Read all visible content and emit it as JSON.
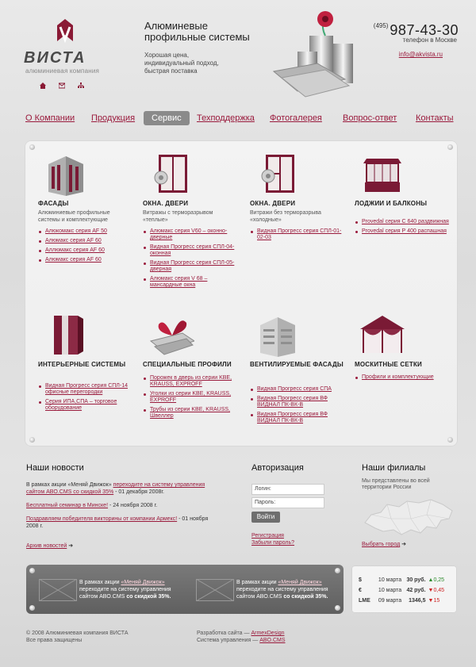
{
  "header": {
    "logo_word": "ВИСТА",
    "logo_sub": "алюминиевая компания",
    "title": "Алюминевые профильные системы",
    "slogan": "Хорошая цена, индивидуальный подход, быстрая поставка",
    "phone_code": "(495)",
    "phone_number": "987-43-30",
    "phone_label": "телефон в Москве",
    "email": "info@akvista.ru",
    "icons": [
      "home-icon",
      "mail-icon",
      "sitemap-icon"
    ]
  },
  "nav": {
    "items": [
      "О Компании",
      "Продукция",
      "Сервис",
      "Техподдержка",
      "Фотогалерея",
      "Вопрос-ответ",
      "Контакты"
    ],
    "active_index": 2
  },
  "catalog": [
    {
      "title": "ФАСАДЫ",
      "desc": "Алюминиевые профильные системы и комплектующие",
      "links": [
        "Алюкомакс серия AF 50",
        "Алюмакс серия AF 60",
        "Аллюмакс серия AF 60",
        "Алюмакс серия AF 60"
      ]
    },
    {
      "title": "ОКНА. ДВЕРИ",
      "desc": "Витражы с терморазрывом «теплые»",
      "links": [
        "Алюмакс серия V60 – оконно-дверные",
        "Видная Прогресс серия СПЛ-04-оконная",
        "Видная Прогресс серия СПЛ-05- дверная",
        "Алюмакс серия V 68 – мансардные окна"
      ]
    },
    {
      "title": "ОКНА. ДВЕРИ",
      "desc": "Витражи без терморазрыва «холодные»",
      "links": [
        "Видная Прогресс серия СПЛ-01-02-03"
      ]
    },
    {
      "title": "ЛОДЖИИ И БАЛКОНЫ",
      "desc": "",
      "links": [
        "Provedal серия С 640 раздвижная",
        "Provedal серия Р 400 распашная"
      ]
    },
    {
      "title": "ИНТЕРЬЕРНЫЕ СИСТЕМЫ",
      "desc": "",
      "links": [
        "Видная Прогресс серия СПЛ-14 офисные перегородки",
        "Серия ИПА,СПА – торговое оборудование"
      ]
    },
    {
      "title": "СПЕЦИАЛЬНЫЕ ПРОФИЛИ",
      "desc": "",
      "links": [
        "Порожек в дверь из серии KBE, KRAUSS, EXPROFF",
        "Уголки из серии KBE, KRAUSS, EXPROFF",
        "Трубы из серии KBE, KRAUSS, Швеллер"
      ]
    },
    {
      "title": "ВЕНТИЛИРУЕМЫЕ ФАСАДЫ",
      "desc": "",
      "links": [
        "Видная Прогресс серия СПА",
        "Видная Прогресс серия ВФ ВИДНАЛ ПК-ВК-В",
        "Видная Прогресс серия ВФ ВИДНАЛ ПК-ВК-В"
      ]
    },
    {
      "title": "МОСКИТНЫЕ СЕТКИ",
      "desc": "",
      "links": [
        "Профили и комплектующие"
      ]
    }
  ],
  "news": {
    "title": "Наши новости",
    "items": [
      {
        "pre": "В рамках акции «Меняй Движок» ",
        "link": "переходите на систему управления сайтом ABO.CMS со скидкой 35%",
        "post": " - 01 декабря 2008г."
      },
      {
        "pre": "",
        "link": "Бесплатный семинар в Минске!",
        "post": " - 24 ноября 2008 г."
      },
      {
        "pre": "",
        "link": "Поздравляем победителя викторины от компании Армекс!",
        "post": " - 01 ноября 2008 г."
      }
    ],
    "archive": "Архив новостей"
  },
  "auth": {
    "title": "Авторизация",
    "login_placeholder": "Логин:",
    "password_placeholder": "Пароль:",
    "submit": "Войти",
    "register": "Регистрация",
    "forgot": "Забыли пароль?"
  },
  "branches": {
    "title": "Наши филиалы",
    "text": "Мы представлены во всей территории России",
    "region_link": "Выбрать город"
  },
  "promo": [
    {
      "pre": "В рамках акции ",
      "link": "«Меняй Движок»",
      "mid": " переходите на систему управления сайтом ABO.CMS ",
      "bold": "со скидкой 35%."
    },
    {
      "pre": "В рамках акции ",
      "link": "«Меняй Движок»",
      "mid": " переходите на систему управления сайтом ABO.CMS ",
      "bold": "со скидкой 35%."
    }
  ],
  "rates": [
    {
      "cur": "$",
      "date": "10 марта",
      "value": "30 руб.",
      "dir": "up",
      "change": "0,25"
    },
    {
      "cur": "€",
      "date": "10 марта",
      "value": "42 руб.",
      "dir": "down",
      "change": "0,45"
    },
    {
      "cur": "LME",
      "date": "09 марта",
      "value": "1346,5",
      "dir": "down",
      "change": "15"
    }
  ],
  "footer": {
    "copyright": "© 2008 Алюминиевая компания ВИСТА",
    "rights": "Все права защищены",
    "dev_pre": "Разработка сайта — ",
    "dev_link": "ArmexDesign",
    "cms_pre": "Система управления — ",
    "cms_link": "ABO.CMS"
  },
  "colors": {
    "accent": "#9a1a3c",
    "nav_active": "#8a8a8a"
  }
}
